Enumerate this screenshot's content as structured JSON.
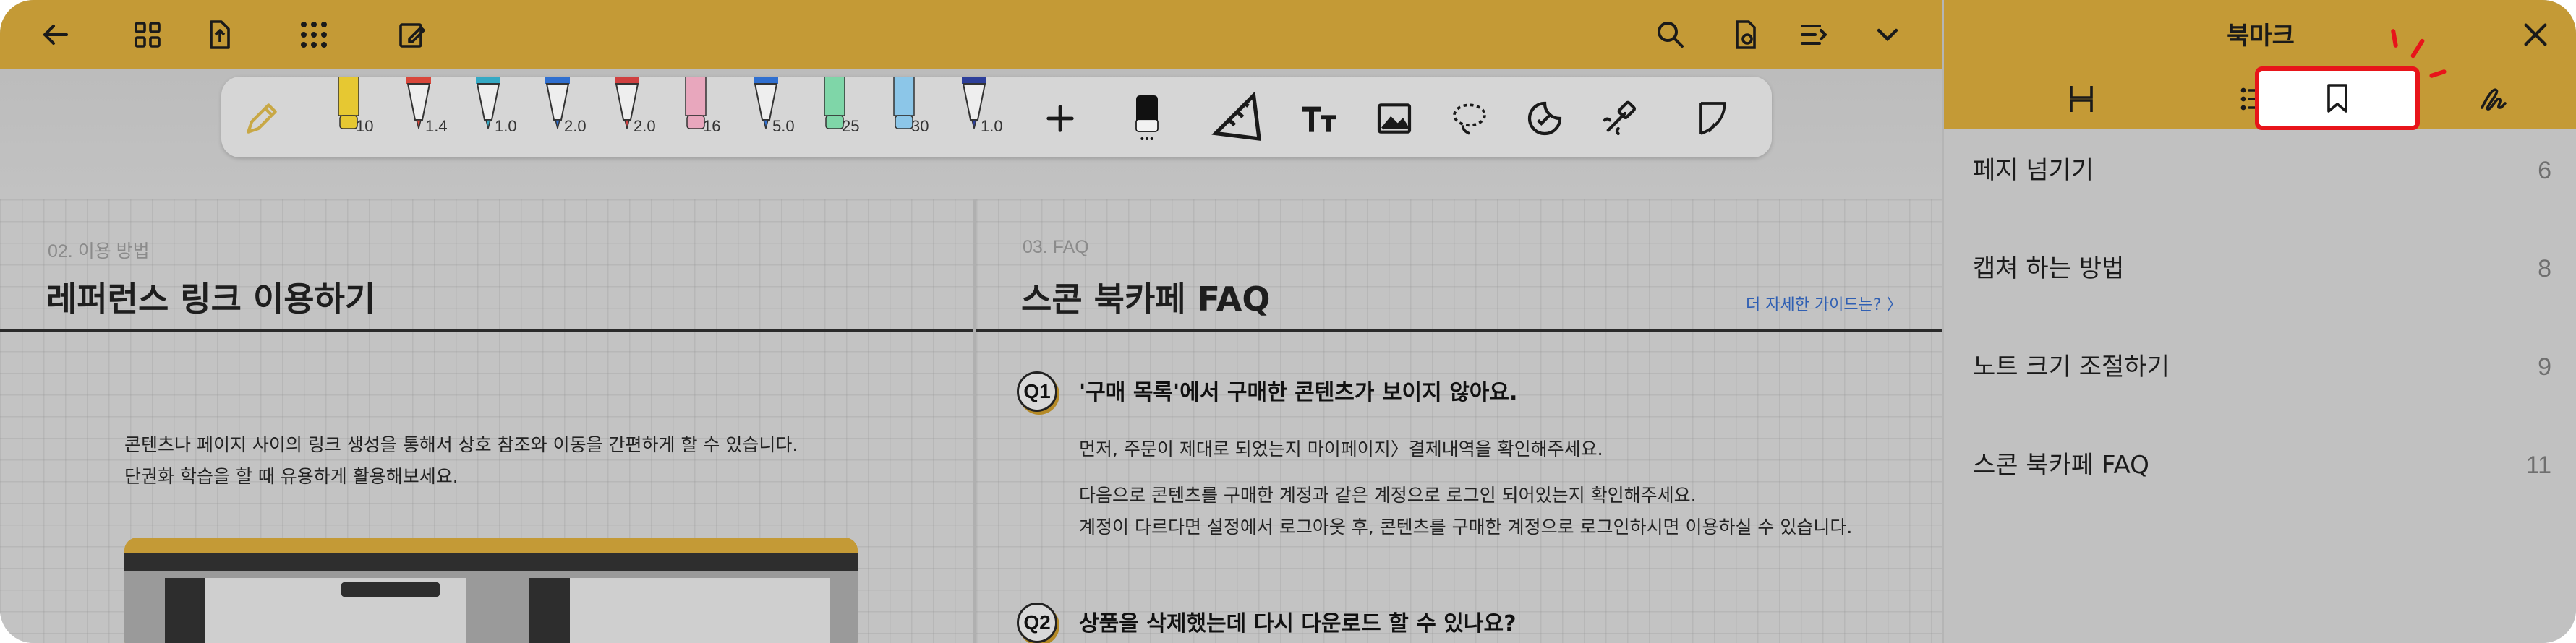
{
  "toolbar": {
    "pens": [
      {
        "name": "yellow-highlighter",
        "color": "#e6c832",
        "size": "10"
      },
      {
        "name": "red-pen",
        "color": "#d9473b",
        "size": "1.4"
      },
      {
        "name": "cyan-pen",
        "color": "#35a9c4",
        "size": "1.0"
      },
      {
        "name": "blue-pen",
        "color": "#2f6fd0",
        "size": "2.0"
      },
      {
        "name": "red-pen-2",
        "color": "#d04040",
        "size": "2.0"
      },
      {
        "name": "pink-highlighter",
        "color": "#e8a7bd",
        "size": "16"
      },
      {
        "name": "blue-pen-2",
        "color": "#2f6fd0",
        "size": "5.0"
      },
      {
        "name": "green-highlighter",
        "color": "#7fd6a8",
        "size": "25"
      },
      {
        "name": "sky-highlighter",
        "color": "#8cc6e8",
        "size": "30"
      },
      {
        "name": "navy-pen",
        "color": "#2d3f9a",
        "size": "1.0"
      }
    ]
  },
  "left_page": {
    "section": "02. 이용 방법",
    "title": "레퍼런스 링크 이용하기",
    "body_lines": [
      "콘텐츠나 페이지 사이의 링크 생성을 통해서 상호 참조와 이동을 간편하게 할 수 있습니다.",
      "단권화 학습을 할 때 유용하게 활용해보세요."
    ]
  },
  "right_page": {
    "section": "03. FAQ",
    "title": "스콘 북카페 FAQ",
    "more_link": "더 자세한 가이드는? 〉",
    "q1": {
      "badge": "Q1",
      "question": "'구매 목록'에서 구매한 콘텐츠가 보이지 않아요.",
      "answer_1": "먼저, 주문이 제대로 되었는지 마이페이지〉결제내역을 확인해주세요.",
      "answer_2": "다음으로 콘텐츠를 구매한 계정과 같은 계정으로 로그인 되어있는지 확인해주세요.",
      "answer_3": "계정이 다르다면 설정에서 로그아웃 후, 콘텐츠를 구매한 계정으로 로그인하시면 이용하실 수 있습니다."
    },
    "q2": {
      "badge": "Q2",
      "question": "상품을 삭제했는데 다시 다운로드 할 수 있나요?"
    }
  },
  "panel": {
    "title": "북마크",
    "active_tab": "bookmark",
    "highlight_color": "#e8141a",
    "bookmarks": [
      {
        "label": "페지 넘기기",
        "page": "6"
      },
      {
        "label": "캡쳐 하는 방법",
        "page": "8"
      },
      {
        "label": "노트 크기 조절하기",
        "page": "9"
      },
      {
        "label": "스콘 북카페 FAQ",
        "page": "11"
      }
    ]
  },
  "colors": {
    "accent": "#c49a36",
    "background": "#c1c1c1"
  }
}
